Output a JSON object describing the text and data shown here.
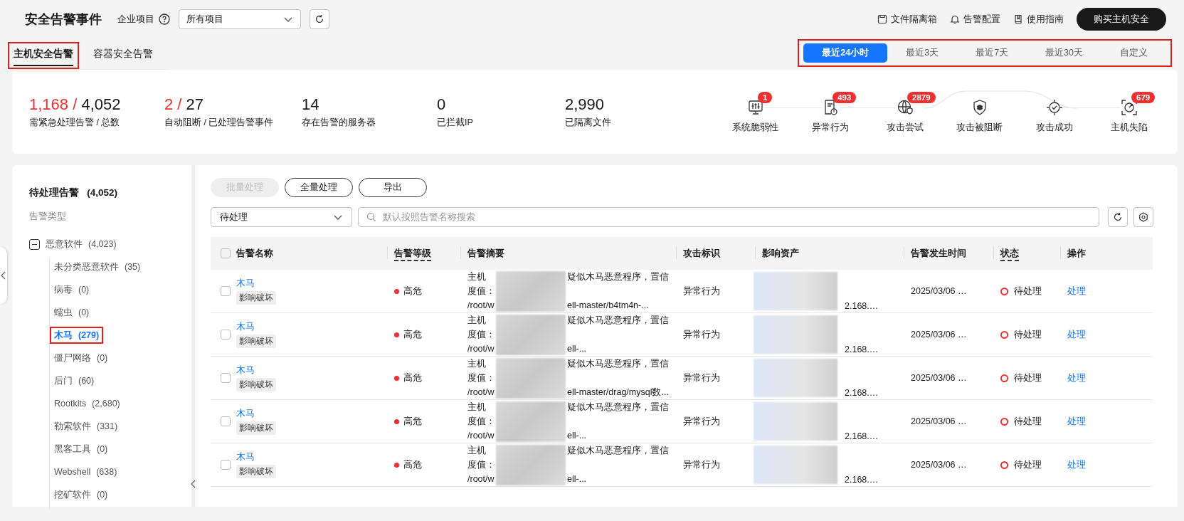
{
  "header": {
    "title": "安全告警事件",
    "project_label": "企业项目",
    "project_select": "所有项目",
    "links": [
      "文件隔离箱",
      "告警配置",
      "使用指南"
    ],
    "buy_button": "购买主机安全"
  },
  "tabs": [
    {
      "label": "主机安全告警",
      "selected": true,
      "highlighted": true
    },
    {
      "label": "容器安全告警",
      "selected": false,
      "highlighted": false
    }
  ],
  "time_range": {
    "highlighted": true,
    "options": [
      {
        "label": "最近24小时",
        "selected": true
      },
      {
        "label": "最近3天",
        "selected": false
      },
      {
        "label": "最近7天",
        "selected": false
      },
      {
        "label": "最近30天",
        "selected": false
      },
      {
        "label": "自定义",
        "selected": false
      }
    ]
  },
  "stats": [
    {
      "highlight": "1,168 /",
      "value": "4,052",
      "label": "需紧急处理告警  / 总数"
    },
    {
      "highlight": "2 /",
      "value": "27",
      "label": "自动阻断  / 已处理告警事件"
    },
    {
      "value": "14",
      "label": "存在告警的服务器"
    },
    {
      "value": "0",
      "label": "已拦截IP"
    },
    {
      "value": "2,990",
      "label": "已隔离文件"
    }
  ],
  "stages": [
    {
      "label": "系统脆弱性",
      "count": "1"
    },
    {
      "label": "异常行为",
      "count": "493"
    },
    {
      "label": "攻击尝试",
      "count": "2879"
    },
    {
      "label": "攻击被阻断"
    },
    {
      "label": "攻击成功"
    },
    {
      "label": "主机失陷",
      "count": "679"
    }
  ],
  "sidebar": {
    "title": "待处理告警",
    "count": "(4,052)",
    "subtitle": "告警类型",
    "tree": [
      {
        "label": "恶意软件",
        "count": "(4,023)",
        "expanded": true,
        "selected": false,
        "highlighted": false,
        "children": [
          {
            "label": "未分类恶意软件",
            "count": "(35)",
            "selected": false,
            "highlighted": false
          },
          {
            "label": "病毒",
            "count": "(0)",
            "selected": false,
            "highlighted": false
          },
          {
            "label": "蠕虫",
            "count": "(0)",
            "selected": false,
            "highlighted": false
          },
          {
            "label": "木马",
            "count": "(279)",
            "selected": true,
            "highlighted": true
          },
          {
            "label": "僵尸网络",
            "count": "(0)",
            "selected": false,
            "highlighted": false
          },
          {
            "label": "后门",
            "count": "(60)",
            "selected": false,
            "highlighted": false
          },
          {
            "label": "Rootkits",
            "count": "(2,680)",
            "selected": false,
            "highlighted": false
          },
          {
            "label": "勒索软件",
            "count": "(331)",
            "selected": false,
            "highlighted": false
          },
          {
            "label": "黑客工具",
            "count": "(0)",
            "selected": false,
            "highlighted": false
          },
          {
            "label": "Webshell",
            "count": "(638)",
            "selected": false,
            "highlighted": false
          },
          {
            "label": "挖矿软件",
            "count": "(0)",
            "selected": false,
            "highlighted": false
          }
        ]
      }
    ]
  },
  "toolbar": {
    "buttons": [
      {
        "label": "批量处理",
        "disabled": true
      },
      {
        "label": "全量处理",
        "disabled": false
      },
      {
        "label": "导出",
        "disabled": false
      }
    ],
    "status_filter": "待处理",
    "search_placeholder": "默认按照告警名称搜索"
  },
  "table": {
    "all_checked": false,
    "columns": [
      {
        "label": "告警名称",
        "dashed": false
      },
      {
        "label": "告警等级",
        "dashed": true
      },
      {
        "label": "告警摘要",
        "dashed": false
      },
      {
        "label": "攻击标识",
        "dashed": false
      },
      {
        "label": "影响资产",
        "dashed": false
      },
      {
        "label": "告警发生时间",
        "dashed": false
      },
      {
        "label": "状态",
        "dashed": true
      },
      {
        "label": "操作",
        "dashed": false
      }
    ],
    "rows": [
      {
        "checked": false,
        "name": "木马",
        "tag": "影响破坏",
        "severity": "高危",
        "summary": [
          {
            "left": "主机",
            "right": "疑似木马恶意程序，置信"
          },
          {
            "left": "度值："
          },
          {
            "left": "/root/w",
            "right": "ell-master/b4tm4n-..."
          }
        ],
        "attack": "异常行为",
        "asset": "2.168.…",
        "time": "2025/03/06 …",
        "status": "待处理",
        "action": "处理"
      },
      {
        "checked": false,
        "name": "木马",
        "tag": "影响破坏",
        "severity": "高危",
        "summary": [
          {
            "left": "主机",
            "right": "疑似木马恶意程序，置信"
          },
          {
            "left": "度值："
          },
          {
            "left": "/root/w",
            "right": "ell-..."
          }
        ],
        "attack": "异常行为",
        "asset": "2.168.…",
        "time": "2025/03/06 …",
        "status": "待处理",
        "action": "处理"
      },
      {
        "checked": false,
        "name": "木马",
        "tag": "影响破坏",
        "severity": "高危",
        "summary": [
          {
            "left": "主机",
            "right": "疑似木马恶意程序，置信"
          },
          {
            "left": "度值："
          },
          {
            "left": "/root/w",
            "right": "ell-master/drag/mysql数..."
          }
        ],
        "attack": "异常行为",
        "asset": "2.168.…",
        "time": "2025/03/06 …",
        "status": "待处理",
        "action": "处理"
      },
      {
        "checked": false,
        "name": "木马",
        "tag": "影响破坏",
        "severity": "高危",
        "summary": [
          {
            "left": "主机",
            "right": "疑似木马恶意程序，置信"
          },
          {
            "left": "度值："
          },
          {
            "left": "/root/w",
            "right": "ell-..."
          }
        ],
        "attack": "异常行为",
        "asset": "2.168.…",
        "time": "2025/03/06 …",
        "status": "待处理",
        "action": "处理"
      },
      {
        "checked": false,
        "name": "木马",
        "tag": "影响破坏",
        "severity": "高危",
        "summary": [
          {
            "left": "主机",
            "right": "疑似木马恶意程序，置信"
          },
          {
            "left": "度值："
          },
          {
            "left": "/root/w",
            "right": "ell-..."
          }
        ],
        "attack": "异常行为",
        "asset": "2.168.…",
        "time": "2025/03/06 …",
        "status": "待处理",
        "action": "处理"
      }
    ]
  }
}
